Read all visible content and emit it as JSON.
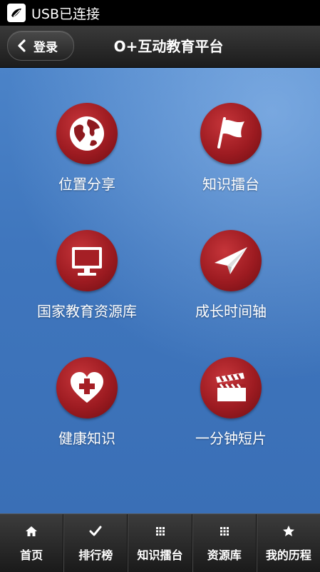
{
  "status_bar": {
    "text": "USB已连接",
    "icon": "usb-debug-icon"
  },
  "header": {
    "back_label": "登录",
    "title": "O+互动教育平台"
  },
  "tiles": [
    {
      "label": "位置分享",
      "icon": "globe-icon"
    },
    {
      "label": "知识擂台",
      "icon": "flag-icon"
    },
    {
      "label": "国家教育资源库",
      "icon": "monitor-icon"
    },
    {
      "label": "成长时间轴",
      "icon": "paper-plane-icon"
    },
    {
      "label": "健康知识",
      "icon": "heart-cross-icon"
    },
    {
      "label": "一分钟短片",
      "icon": "clapperboard-icon"
    }
  ],
  "tabbar": [
    {
      "label": "首页",
      "icon": "home-icon"
    },
    {
      "label": "排行榜",
      "icon": "check-icon"
    },
    {
      "label": "知识擂台",
      "icon": "grid-icon"
    },
    {
      "label": "资源库",
      "icon": "grid-icon"
    },
    {
      "label": "我的历程",
      "icon": "star-icon"
    }
  ],
  "colors": {
    "header_bg": "#2a2a2a",
    "main_bg": "#4279c0",
    "tile_red": "#a51f25",
    "tabbar_bg": "#2b2b2b"
  }
}
